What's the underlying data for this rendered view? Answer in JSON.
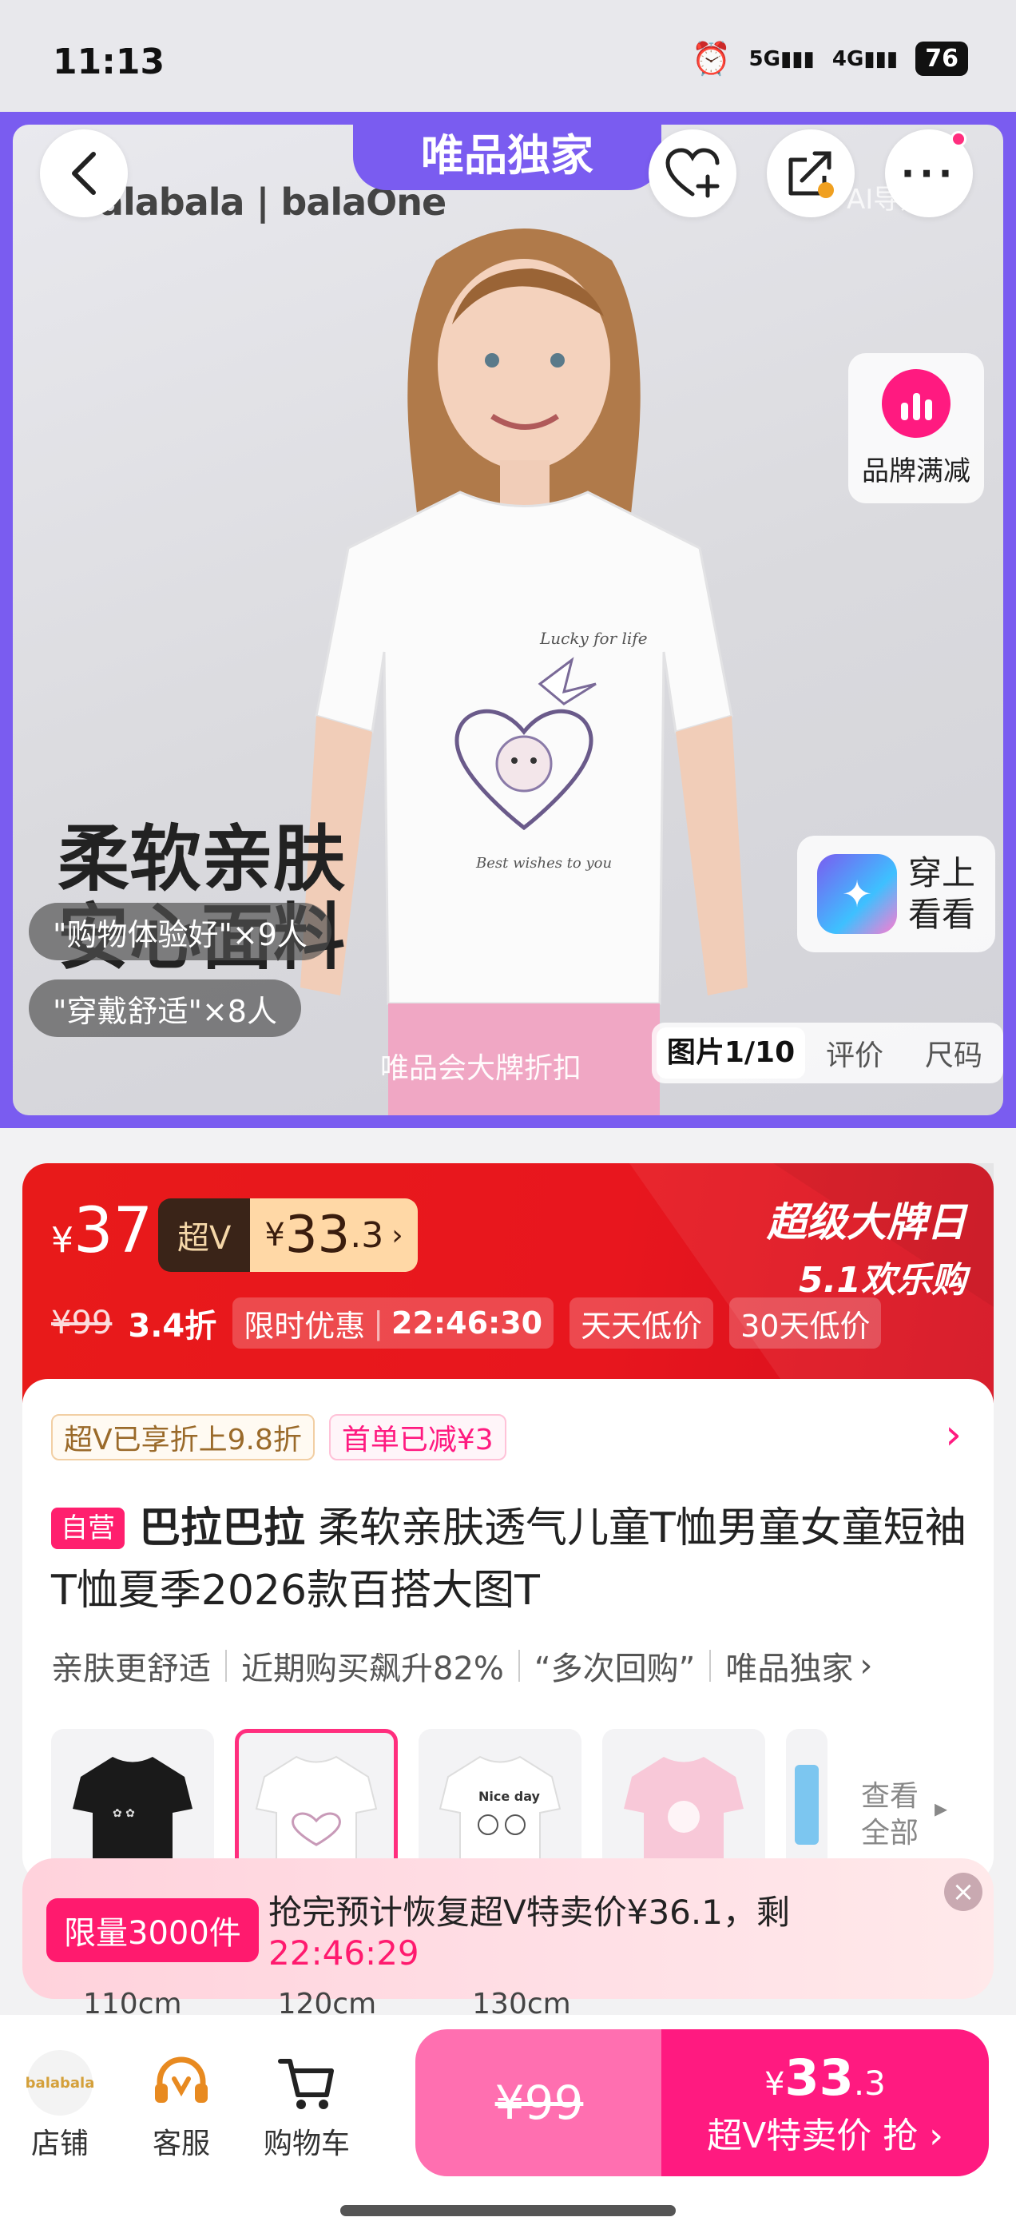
{
  "status": {
    "time": "11:13",
    "net1": "5G",
    "net2": "4G",
    "battery": "76"
  },
  "hero": {
    "exclusive_tab": "唯品独家",
    "brand_logo": "balabala | balaOne",
    "ai_label": "AI导购",
    "brand_discount_label": "品牌满减",
    "try_on_label_1": "穿上",
    "try_on_label_2": "看看",
    "headline_1": "柔软亲肤",
    "headline_2": "安心面料",
    "bubble_1": "\"购物体验好\"×9人",
    "bubble_2": "\"穿戴舒适\"×8人",
    "watermark": "唯品会大牌折扣",
    "tabs": [
      "图片1/10",
      "评价",
      "尺码"
    ],
    "print_text_1": "Lucky for life",
    "print_text_2": "Best wishes to you"
  },
  "price": {
    "currency": "¥",
    "price": "37",
    "superv_label": "超V",
    "superv_int": "33",
    "superv_dec": ".3",
    "original": "¥99",
    "discount": "3.4折",
    "limited_label": "限时优惠",
    "countdown": "22:46:30",
    "tag_daily_low": "天天低价",
    "tag_30day_low": "30天低价",
    "event_line_1": "超级大牌日",
    "event_line_2": "5.1欢乐购"
  },
  "detail": {
    "chip_superv": "超V已享折上9.8折",
    "chip_first": "首单已减¥3",
    "self_tag": "自营",
    "brand": "巴拉巴拉",
    "title": "柔软亲肤透气儿童T恤男童女童短袖T恤夏季2026款百搭大图T",
    "features": [
      "亲肤更舒适",
      "近期购买飙升82%",
      "“多次回购”",
      "唯品独家"
    ],
    "view_all_1": "查看",
    "view_all_2": "全部",
    "sizes": [
      "110cm",
      "120cm",
      "130cm"
    ],
    "thumb_text": "Nice day"
  },
  "banner": {
    "limit_tag": "限量3000件",
    "text": "抢完预计恢复超V特卖价¥36.1，剩",
    "countdown": "22:46:29"
  },
  "bottom": {
    "shop_logo": "balabala",
    "shop": "店铺",
    "service": "客服",
    "cart": "购物车",
    "orig_price": "¥99",
    "buy_price_yen": "¥",
    "buy_price_int": "33",
    "buy_price_dec": ".3",
    "buy_label": "超V特卖价 抢"
  },
  "colors": {
    "accent": "#ff1a80",
    "purple": "#7a5cf0",
    "red": "#e8161e"
  }
}
